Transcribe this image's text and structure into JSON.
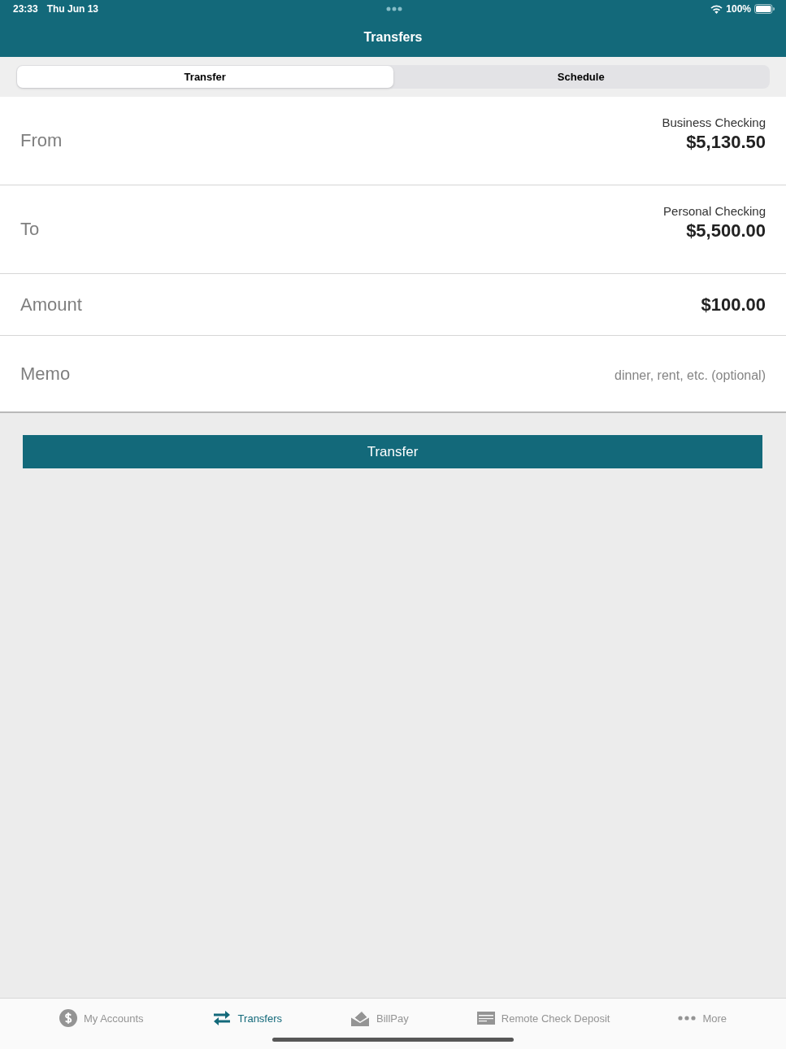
{
  "status_bar": {
    "time": "23:33",
    "date": "Thu Jun 13",
    "battery": "100%"
  },
  "nav_bar": {
    "title": "Transfers"
  },
  "segments": [
    {
      "label": "Transfer",
      "selected": true
    },
    {
      "label": "Schedule",
      "selected": false
    }
  ],
  "form": [
    {
      "kind": "account",
      "label": "From",
      "account": "Business Checking",
      "balance": "$5,130.50"
    },
    {
      "kind": "account",
      "label": "To",
      "account": "Personal Checking",
      "balance": "$5,500.00"
    },
    {
      "kind": "amount",
      "label": "Amount",
      "value": "$100.00"
    },
    {
      "kind": "memo",
      "label": "Memo",
      "placeholder": "dinner, rent, etc. (optional)"
    }
  ],
  "transfer_button": {
    "label": "Transfer"
  },
  "tab_bar": [
    {
      "label": "My Accounts",
      "selected": false
    },
    {
      "label": "Transfers",
      "selected": true
    },
    {
      "label": "BillPay",
      "selected": false
    },
    {
      "label": "Remote Check Deposit",
      "selected": false
    },
    {
      "label": "More",
      "selected": false
    }
  ]
}
